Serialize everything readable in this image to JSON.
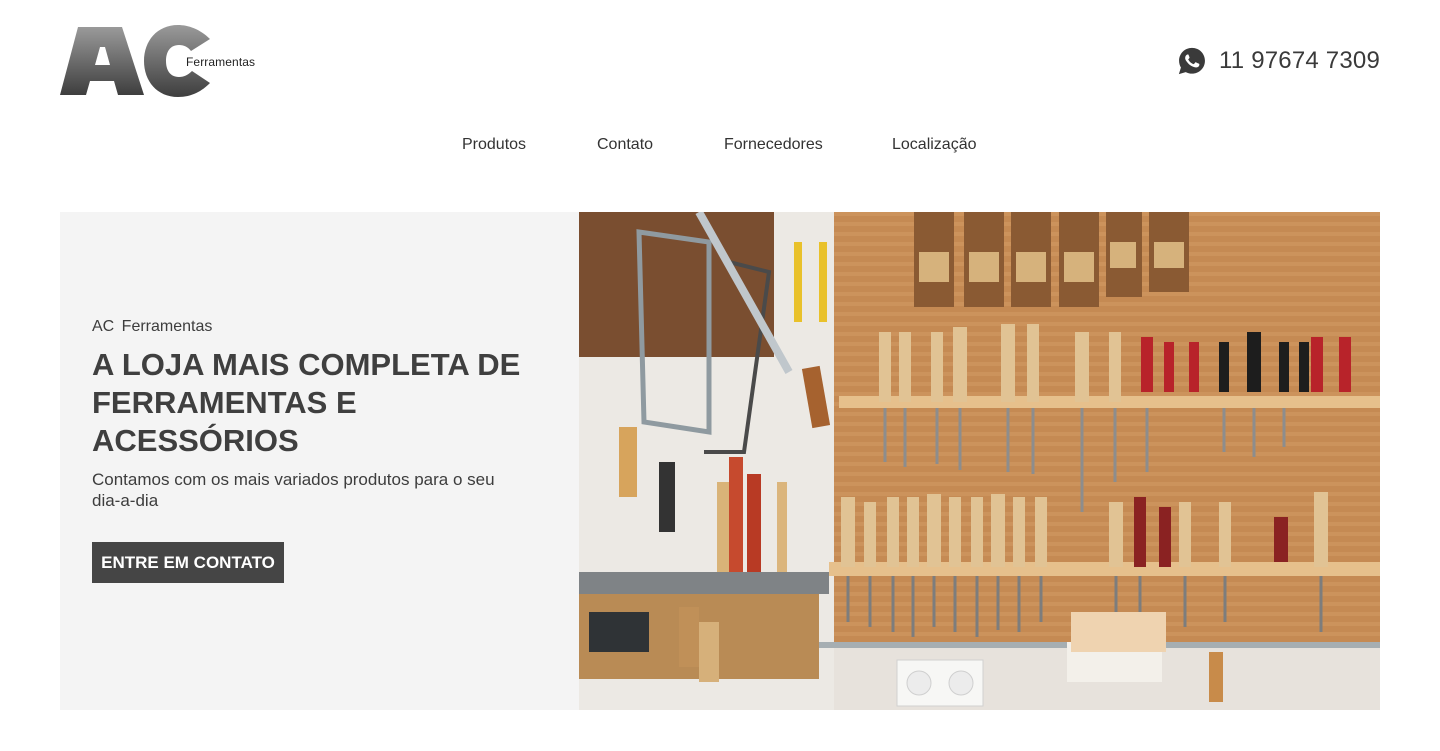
{
  "brand": {
    "letters": "AC",
    "name": "Ferramentas"
  },
  "contact": {
    "icon": "whatsapp-icon",
    "phone": "11 97674 7309"
  },
  "nav": {
    "items": [
      {
        "label": "Produtos"
      },
      {
        "label": "Contato"
      },
      {
        "label": "Fornecedores"
      },
      {
        "label": "Localização"
      }
    ]
  },
  "hero": {
    "eyebrow": "AC Ferramentas",
    "headline": "A LOJA MAIS COMPLETA DE FERRAMENTAS E ACESSÓRIOS",
    "subtext": "Contamos com os mais variados produtos para o seu dia-a-dia",
    "cta_label": "ENTRE EM CONTATO",
    "image_alt": "tool-wall-photo"
  },
  "colors": {
    "text": "#3d3d3d",
    "cta_bg": "#454545",
    "hero_bg": "#f4f4f4"
  }
}
